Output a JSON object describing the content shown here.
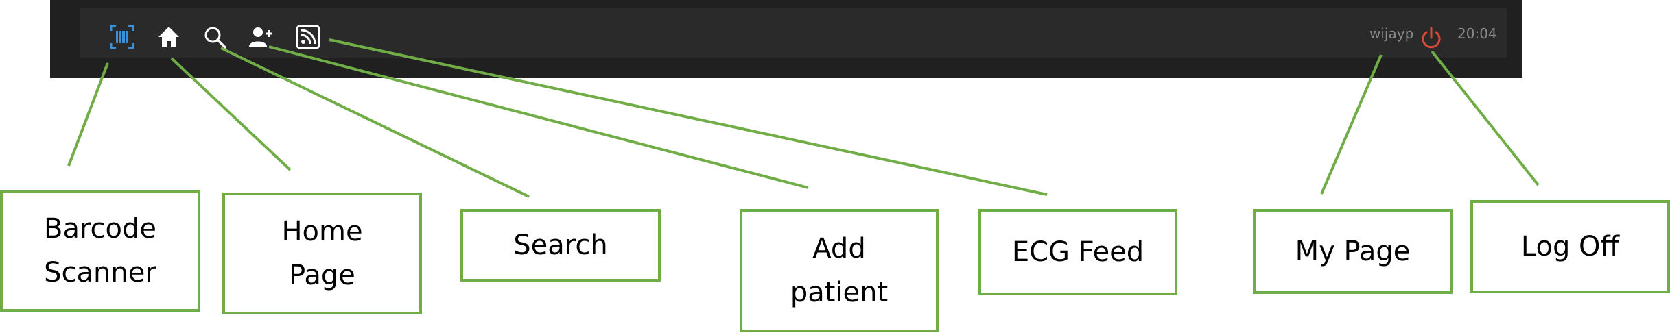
{
  "toolbar": {
    "username": "wijayp",
    "clock": "20:04",
    "icons": [
      "barcode-scanner-icon",
      "home-icon",
      "search-icon",
      "add-user-icon",
      "rss-feed-icon",
      "power-icon"
    ],
    "colors": {
      "frame": "#202020",
      "bar": "#2a2a2a",
      "barcode": "#3a8fd6",
      "power": "#d94a38",
      "icon": "#ffffff"
    }
  },
  "callouts": {
    "barcode": "Barcode\nScanner",
    "home": "Home\nPage",
    "search": "Search",
    "add_patient": "Add\npatient",
    "ecg": "ECG Feed",
    "my_page": "My Page",
    "log_off": "Log Off"
  },
  "colors": {
    "callout_border": "#70ad47",
    "connector": "#70ad47"
  }
}
